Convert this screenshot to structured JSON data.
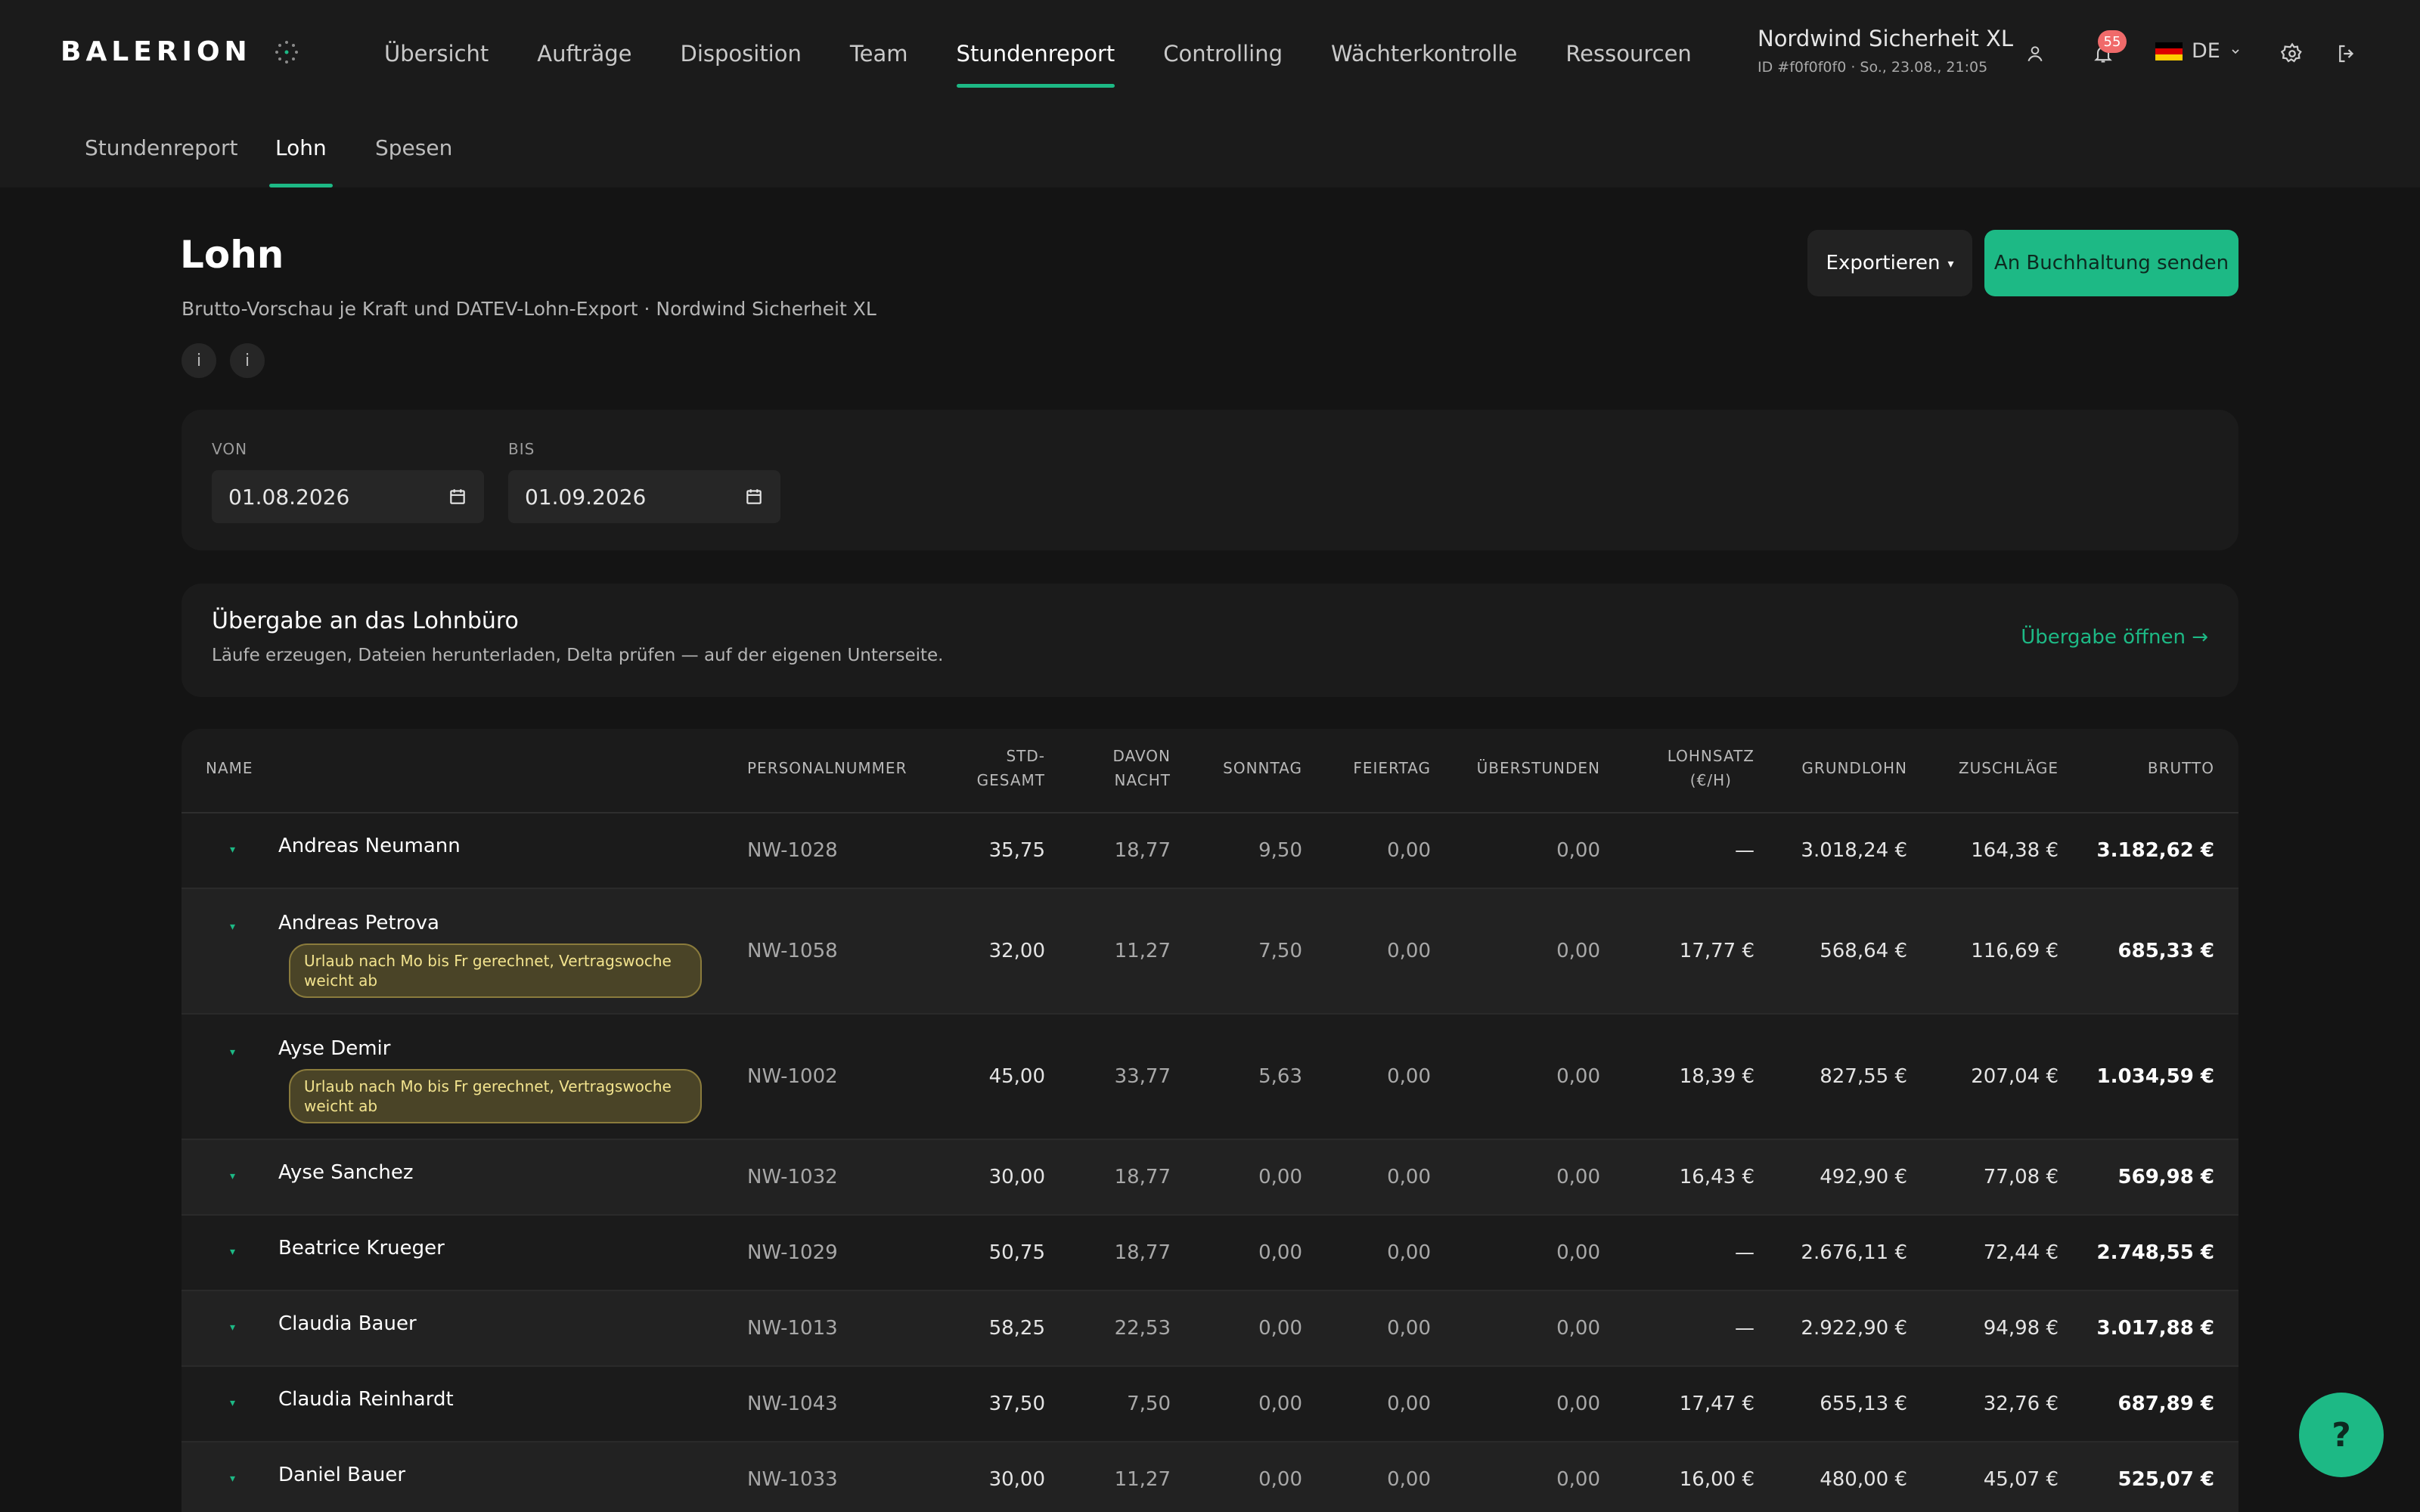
{
  "header": {
    "logo_text": "BALERION",
    "nav": [
      "Übersicht",
      "Aufträge",
      "Disposition",
      "Team",
      "Stundenreport",
      "Controlling",
      "Wächterkontrolle",
      "Ressourcen"
    ],
    "active_nav": "Stundenreport",
    "org_name": "Nordwind Sicherheit XL",
    "org_meta": "ID #f0f0f0f0 · So., 23.08., 21:05",
    "notifications_count": "55",
    "language": "DE"
  },
  "subnav": {
    "items": [
      "Stundenreport",
      "Lohn",
      "Spesen"
    ],
    "active": "Lohn"
  },
  "page": {
    "title": "Lohn",
    "subtitle": "Brutto-Vorschau je Kraft und DATEV-Lohn-Export · Nordwind Sicherheit XL",
    "info_icon_1": "i",
    "info_icon_2": "i",
    "export_label": "Exportieren",
    "export_caret": "▾",
    "send_label": "An Buchhaltung senden"
  },
  "filters": {
    "from_label": "VON",
    "from_value": "01.08.2026",
    "to_label": "BIS",
    "to_value": "01.09.2026"
  },
  "handover": {
    "title": "Übergabe an das Lohnbüro",
    "text": "Läufe erzeugen, Dateien herunterladen, Delta prüfen — auf der eigenen Unterseite.",
    "link": "Übergabe öffnen →"
  },
  "table": {
    "headers": {
      "name": "NAME",
      "personal": "PERSONALNUMMER",
      "std": "STD-\nGESAMT",
      "nacht": "DAVON\nNACHT",
      "sonntag": "SONNTAG",
      "feiertag": "FEIERTAG",
      "ueber": "ÜBERSTUNDEN",
      "lohnsatz": "LOHNSATZ\n(€/H)",
      "grund": "GRUNDLOHN",
      "zuschlag": "ZUSCHLÄGE",
      "brutto": "BRUTTO"
    },
    "caret": "▾",
    "rows": [
      {
        "name": "Andreas Neumann",
        "pn": "NW-1028",
        "std": "35,75",
        "nacht": "18,77",
        "sonntag": "9,50",
        "feiertag": "0,00",
        "ueber": "0,00",
        "lohnsatz": "—",
        "grund": "3.018,24 €",
        "zuschlag": "164,38 €",
        "brutto": "3.182,62 €",
        "warning": ""
      },
      {
        "name": "Andreas Petrova",
        "pn": "NW-1058",
        "std": "32,00",
        "nacht": "11,27",
        "sonntag": "7,50",
        "feiertag": "0,00",
        "ueber": "0,00",
        "lohnsatz": "17,77 €",
        "grund": "568,64 €",
        "zuschlag": "116,69 €",
        "brutto": "685,33 €",
        "warning": "Urlaub nach Mo bis Fr gerechnet, Vertragswoche weicht ab"
      },
      {
        "name": "Ayse Demir",
        "pn": "NW-1002",
        "std": "45,00",
        "nacht": "33,77",
        "sonntag": "5,63",
        "feiertag": "0,00",
        "ueber": "0,00",
        "lohnsatz": "18,39 €",
        "grund": "827,55 €",
        "zuschlag": "207,04 €",
        "brutto": "1.034,59 €",
        "warning": "Urlaub nach Mo bis Fr gerechnet, Vertragswoche weicht ab"
      },
      {
        "name": "Ayse Sanchez",
        "pn": "NW-1032",
        "std": "30,00",
        "nacht": "18,77",
        "sonntag": "0,00",
        "feiertag": "0,00",
        "ueber": "0,00",
        "lohnsatz": "16,43 €",
        "grund": "492,90 €",
        "zuschlag": "77,08 €",
        "brutto": "569,98 €",
        "warning": ""
      },
      {
        "name": "Beatrice Krueger",
        "pn": "NW-1029",
        "std": "50,75",
        "nacht": "18,77",
        "sonntag": "0,00",
        "feiertag": "0,00",
        "ueber": "0,00",
        "lohnsatz": "—",
        "grund": "2.676,11 €",
        "zuschlag": "72,44 €",
        "brutto": "2.748,55 €",
        "warning": ""
      },
      {
        "name": "Claudia Bauer",
        "pn": "NW-1013",
        "std": "58,25",
        "nacht": "22,53",
        "sonntag": "0,00",
        "feiertag": "0,00",
        "ueber": "0,00",
        "lohnsatz": "—",
        "grund": "2.922,90 €",
        "zuschlag": "94,98 €",
        "brutto": "3.017,88 €",
        "warning": ""
      },
      {
        "name": "Claudia Reinhardt",
        "pn": "NW-1043",
        "std": "37,50",
        "nacht": "7,50",
        "sonntag": "0,00",
        "feiertag": "0,00",
        "ueber": "0,00",
        "lohnsatz": "17,47 €",
        "grund": "655,13 €",
        "zuschlag": "32,76 €",
        "brutto": "687,89 €",
        "warning": ""
      },
      {
        "name": "Daniel Bauer",
        "pn": "NW-1033",
        "std": "30,00",
        "nacht": "11,27",
        "sonntag": "0,00",
        "feiertag": "0,00",
        "ueber": "0,00",
        "lohnsatz": "16,00 €",
        "grund": "480,00 €",
        "zuschlag": "45,07 €",
        "brutto": "525,07 €",
        "warning": ""
      }
    ]
  },
  "help_label": "?",
  "colors": {
    "accent": "#1db985",
    "background": "#141414",
    "surface": "#1b1b1b",
    "warning_bg": "#4a4427",
    "warning_text": "#f2e38e",
    "badge": "#f06a6a"
  },
  "icons": [
    "user-icon",
    "bell-icon",
    "flag-de-icon",
    "chevron-down-icon",
    "gear-icon",
    "logout-icon",
    "calendar-icon",
    "info-icon",
    "help-icon"
  ]
}
